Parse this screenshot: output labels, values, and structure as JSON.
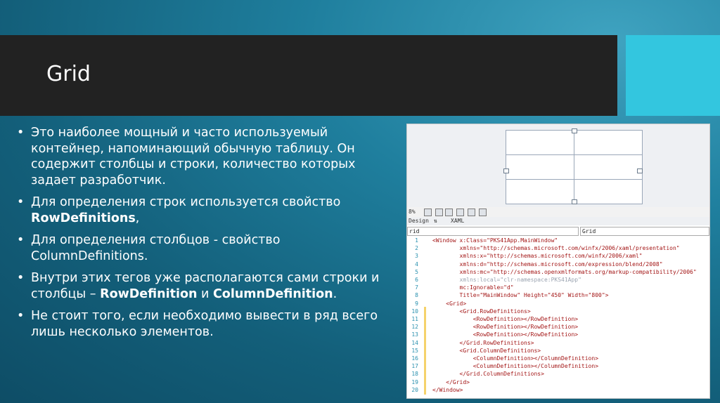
{
  "slide": {
    "title": "Grid",
    "bullets": [
      {
        "text": "Это наиболее мощный и часто используемый контейнер, напоминающий обычную таблицу. Он содержит столбцы и строки, количество которых задает разработчик."
      },
      {
        "text": "Для определения строк используется свойство ",
        "bold": "RowDefinitions",
        "after": ","
      },
      {
        "text": "Для определения столбцов - свойство ",
        "bold": "ColumnDefinitions",
        "after": "."
      },
      {
        "text": "Внутри этих тегов уже располагаются сами строки и столбцы – ",
        "bold": "RowDefinition",
        "mid": " и ",
        "bold2": "ColumnDefinition",
        "after": "."
      },
      {
        "text": "Не стоит того, если необходимо вывести в ряд всего лишь несколько элементов."
      }
    ],
    "colors": {
      "title_bar": "#222222",
      "accent_block": "#33c6df",
      "background": "#1f7f9e"
    }
  },
  "ide": {
    "zoom": "8%",
    "tabs": {
      "design": "Design",
      "xaml": "XAML"
    },
    "element_combo": "rid",
    "scope_combo": "Grid",
    "line_numbers": [
      "1",
      "2",
      "3",
      "4",
      "5",
      "6",
      "7",
      "8",
      "9",
      "10",
      "11",
      "12",
      "13",
      "14",
      "15",
      "16",
      "17",
      "18",
      "19",
      "20"
    ],
    "code_lines": [
      "<Window x:Class=\"PKS41App.MainWindow\"",
      "        xmlns=\"http://schemas.microsoft.com/winfx/2006/xaml/presentation\"",
      "        xmlns:x=\"http://schemas.microsoft.com/winfx/2006/xaml\"",
      "        xmlns:d=\"http://schemas.microsoft.com/expression/blend/2008\"",
      "        xmlns:mc=\"http://schemas.openxmlformats.org/markup-compatibility/2006\"",
      "        xmlns:local=\"clr-namespace:PKS41App\"",
      "        mc:Ignorable=\"d\"",
      "        Title=\"MainWindow\" Height=\"450\" Width=\"800\">",
      "    <Grid>",
      "        <Grid.RowDefinitions>",
      "            <RowDefinition></RowDefinition>",
      "            <RowDefinition></RowDefinition>",
      "            <RowDefinition></RowDefinition>",
      "        </Grid.RowDefinitions>",
      "        <Grid.ColumnDefinitions>",
      "            <ColumnDefinition></ColumnDefinition>",
      "            <ColumnDefinition></ColumnDefinition>",
      "        </Grid.ColumnDefinitions>",
      "    </Grid>",
      "</Window>"
    ]
  }
}
